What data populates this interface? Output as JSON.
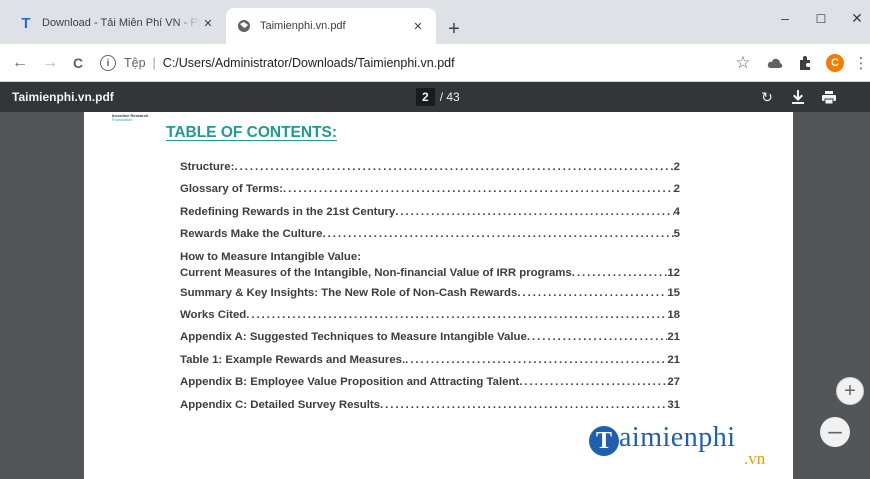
{
  "browser": {
    "tabs": [
      {
        "title": "Download - Tải Miễn Phí VN - Ph",
        "favicon": "T",
        "close": "✕",
        "active": false
      },
      {
        "title": "Taimienphi.vn.pdf",
        "favicon": "globe-icon",
        "close": "✕",
        "active": true
      }
    ],
    "new_tab": "+",
    "window_controls": {
      "minimize": "–",
      "maximize": "☐",
      "close": "✕"
    },
    "nav": {
      "back": "←",
      "forward": "→",
      "reload": "C"
    },
    "address": {
      "info": "i",
      "scheme_label": "Tệp",
      "url": "C:/Users/Administrator/Downloads/Taimienphi.vn.pdf"
    },
    "star": "☆",
    "avatar_letter": "C",
    "menu": "⋮"
  },
  "pdf_viewer": {
    "title": "Taimienphi.vn.pdf",
    "current_page": "2",
    "total_pages": "/ 43",
    "rotate": "↻",
    "download": "⭳",
    "print": "⎙",
    "zoom_in": "+",
    "zoom_out": "–"
  },
  "document": {
    "logo_line1": "Incentive Research",
    "logo_line2": "Foundation",
    "toc_title": "TABLE OF CONTENTS:",
    "entries": [
      {
        "label": "Structure:",
        "page": "2"
      },
      {
        "label": "Glossary of Terms:",
        "page": "2"
      },
      {
        "label": "Redefining Rewards in the 21st Century",
        "page": "4"
      },
      {
        "label": "Rewards Make the Culture",
        "page": "5"
      },
      {
        "label_line1": "How to Measure Intangible Value:",
        "label": "Current Measures of the Intangible, Non-financial Value of IRR programs",
        "page": "12"
      },
      {
        "label": "Summary & Key Insights: The New Role of Non-Cash Rewards",
        "page": "15"
      },
      {
        "label": "Works Cited",
        "page": "18"
      },
      {
        "label": "Appendix A: Suggested Techniques to Measure Intangible Value",
        "page": "21"
      },
      {
        "label": "Table 1: Example Rewards and Measures.",
        "page": "21"
      },
      {
        "label": "Appendix B: Employee Value Proposition and Attracting Talent",
        "page": "27"
      },
      {
        "label": "Appendix C: Detailed Survey Results",
        "page": "31"
      }
    ],
    "watermark": {
      "letter": "T",
      "text": "aimienphi",
      "suffix": ".vn"
    }
  }
}
